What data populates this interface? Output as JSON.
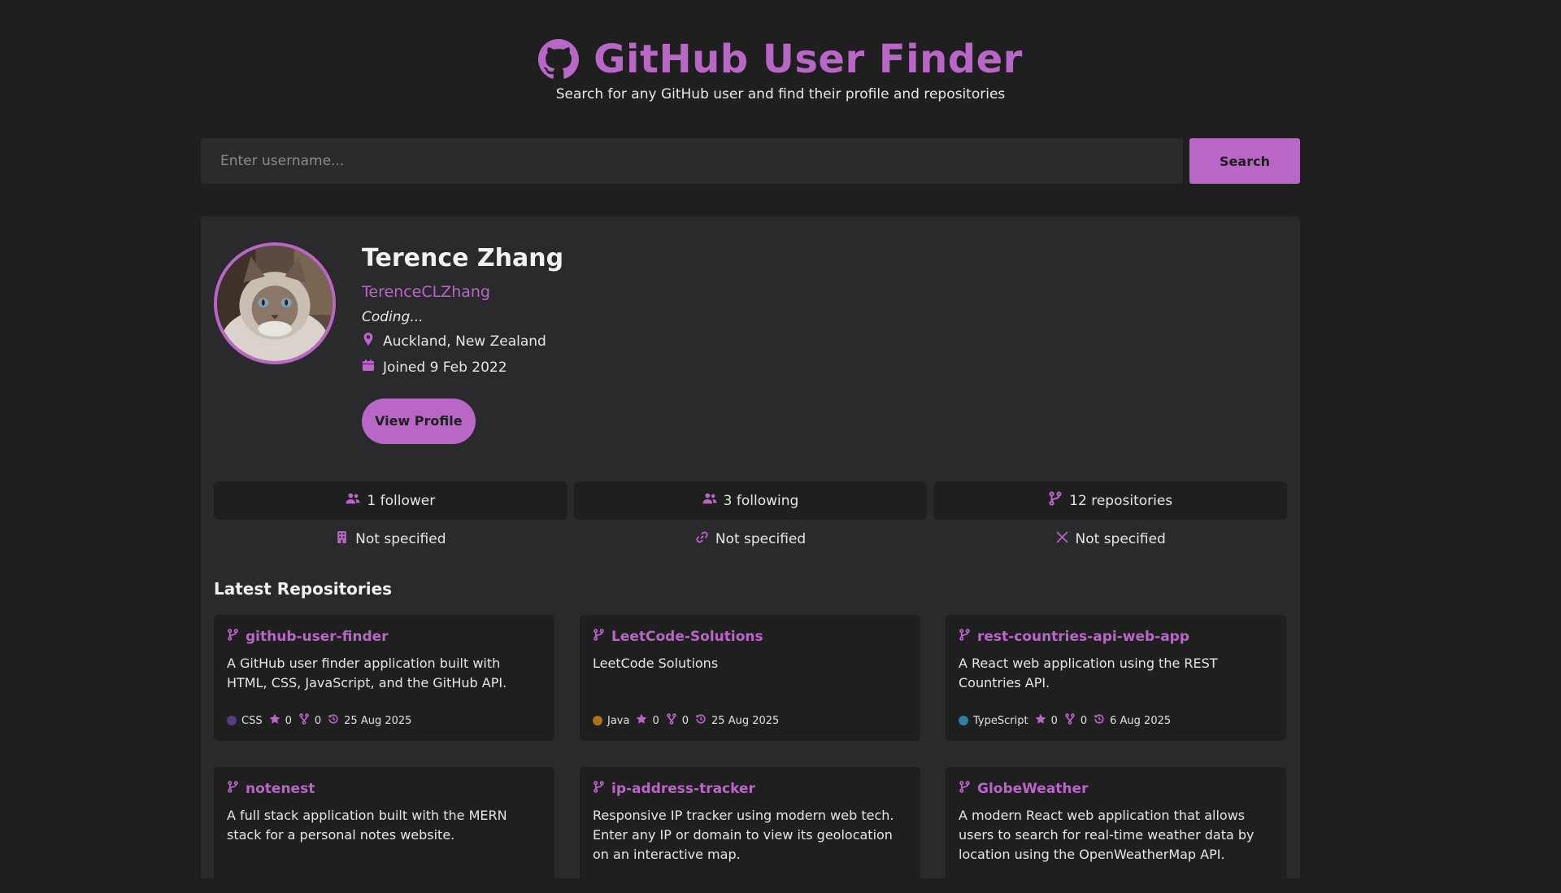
{
  "header": {
    "title": "GitHub User Finder",
    "subtitle": "Search for any GitHub user and find their profile and repositories",
    "logo_icon": "github-icon"
  },
  "search": {
    "placeholder": "Enter username...",
    "value": "",
    "button_label": "Search"
  },
  "colors": {
    "accent": "#b967c7",
    "background": "#1f1f20",
    "card": "#2a292b"
  },
  "profile": {
    "name": "Terence Zhang",
    "login": "TerenceCLZhang",
    "bio": "Coding...",
    "location": "Auckland, New Zealand",
    "joined": "Joined 9 Feb 2022",
    "view_profile_label": "View Profile"
  },
  "stats": {
    "followers": "1 follower",
    "following": "3 following",
    "repositories": "12 repositories"
  },
  "extras": {
    "company": "Not specified",
    "website": "Not specified",
    "twitter": "Not specified"
  },
  "repos_heading": "Latest Repositories",
  "repos": [
    {
      "name": "github-user-finder",
      "description": "A GitHub user finder application built with HTML, CSS, JavaScript, and the GitHub API.",
      "language": "CSS",
      "language_color": "#563d7c",
      "stars": "0",
      "forks": "0",
      "updated": "25 Aug 2025"
    },
    {
      "name": "LeetCode-Solutions",
      "description": "LeetCode Solutions",
      "language": "Java",
      "language_color": "#b07219",
      "stars": "0",
      "forks": "0",
      "updated": "25 Aug 2025"
    },
    {
      "name": "rest-countries-api-web-app",
      "description": "A React web application using the REST Countries API.",
      "language": "TypeScript",
      "language_color": "#3178c6",
      "stars": "0",
      "forks": "0",
      "updated": "6 Aug 2025"
    },
    {
      "name": "notenest",
      "description": "A full stack application built with the MERN stack for a personal notes website."
    },
    {
      "name": "ip-address-tracker",
      "description": "Responsive IP tracker using modern web tech. Enter any IP or domain to view its geolocation on an interactive map."
    },
    {
      "name": "GlobeWeather",
      "description": "A modern React web application that allows users to search for real-time weather data by location using the OpenWeatherMap API."
    }
  ]
}
